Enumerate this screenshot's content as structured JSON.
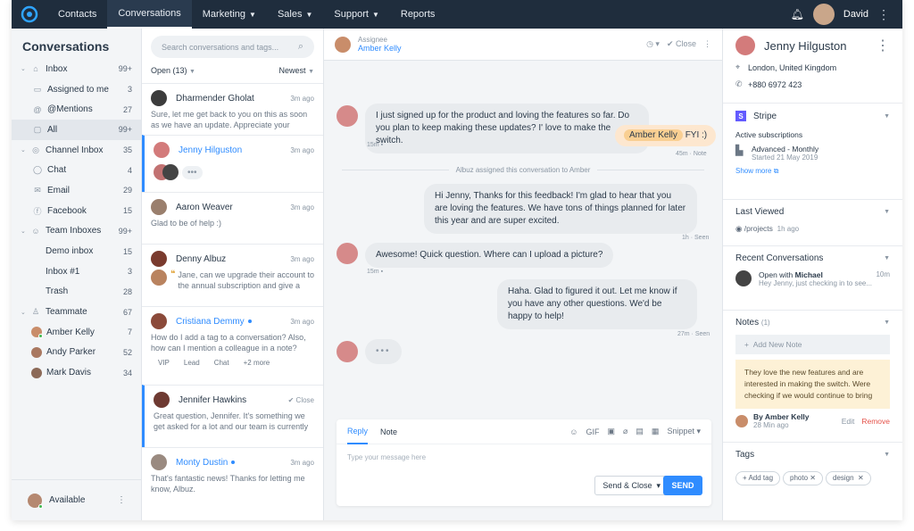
{
  "nav": {
    "items": [
      "Contacts",
      "Conversations",
      "Marketing",
      "Sales",
      "Support",
      "Reports"
    ],
    "user": "David"
  },
  "sidebar": {
    "title": "Conversations",
    "inbox": {
      "label": "Inbox",
      "count": "99+"
    },
    "assigned": {
      "label": "Assigned to me",
      "count": "3"
    },
    "mentions": {
      "label": "@Mentions",
      "count": "27"
    },
    "all": {
      "label": "All",
      "count": "99+"
    },
    "channel": {
      "label": "Channel Inbox",
      "count": "35"
    },
    "chat": {
      "label": "Chat",
      "count": "4"
    },
    "email": {
      "label": "Email",
      "count": "29"
    },
    "facebook": {
      "label": "Facebook",
      "count": "15"
    },
    "team": {
      "label": "Team Inboxes",
      "count": "99+"
    },
    "demo": {
      "label": "Demo inbox",
      "count": "15"
    },
    "inbox1": {
      "label": "Inbox #1",
      "count": "3"
    },
    "trash": {
      "label": "Trash",
      "count": "28"
    },
    "teammate": {
      "label": "Teammate",
      "count": "67"
    },
    "amber": {
      "label": "Amber Kelly",
      "count": "7"
    },
    "andy": {
      "label": "Andy Parker",
      "count": "52"
    },
    "mark": {
      "label": "Mark Davis",
      "count": "34"
    },
    "status": "Available"
  },
  "list": {
    "search_placeholder": "Search conversations and tags...",
    "filter_open": "Open (13)",
    "filter_sort": "Newest",
    "c1": {
      "name": "Dharmender Gholat",
      "time": "3m ago",
      "text": "Sure, let me get back to you on this as soon as we have an update. Appreciate your"
    },
    "c2": {
      "name": "Jenny Hilguston",
      "time": "3m ago"
    },
    "c3": {
      "name": "Aaron Weaver",
      "time": "3m ago",
      "text": "Glad to be of help :)"
    },
    "c4": {
      "name": "Denny Albuz",
      "time": "3m ago",
      "text": "Jane, can we upgrade their account to the annual subscription and give a"
    },
    "c5": {
      "name": "Cristiana Demmy",
      "time": "3m ago",
      "text": "How do I add a tag to a conversation? Also, how can I mention a colleague in a note?",
      "tags": [
        "VIP",
        "Lead",
        "Chat",
        "+2 more"
      ]
    },
    "c6": {
      "name": "Jennifer Hawkins",
      "time": "Close",
      "text": "Great question, Jennifer. It's something we get asked for a lot and our team is currently"
    },
    "c7": {
      "name": "Monty Dustin",
      "time": "3m ago",
      "text": "That's fantastic news! Thanks for letting me know, Albuz."
    }
  },
  "chat": {
    "assignee_label": "Assignee",
    "assignee": "Amber Kelly",
    "close": "Close",
    "m1": "I just signed up for the product and loving the features so far. Do you plan to keep making these updates? I' love to make the switch.",
    "m1_time": "15m",
    "m2_mention": "Amber Kelly",
    "m2": "FYI :)",
    "m2_meta": "45m · Note",
    "system": "Albuz assigned this conversation to Amber",
    "m3": "Hi Jenny, Thanks for this feedback! I'm glad to hear that you are loving the features. We have tons of things planned for later this year and are super excited.",
    "m3_meta": "1h · Seen",
    "m4": "Awesome! Quick question. Where can I upload a picture?",
    "m4_time": "15m",
    "m5": "Haha. Glad to figured it out. Let me know if you have any other questions. We'd be happy to help!",
    "m5_meta": "27m · Seen",
    "tab_reply": "Reply",
    "tab_note": "Note",
    "gif": "GIF",
    "snippet": "Snippet",
    "placeholder": "Type your message here",
    "send_close": "Send & Close",
    "send": "SEND"
  },
  "right": {
    "name": "Jenny Hilguston",
    "location": "London, United Kingdom",
    "phone": "+880 6972 423",
    "stripe": "Stripe",
    "active_subs": "Active subscriptions",
    "plan": "Advanced - Monthly",
    "plan_date": "Started 21 May 2019",
    "show_more": "Show more",
    "last_viewed": "Last Viewed",
    "lv_path": "/projects",
    "lv_time": "1h ago",
    "recent": "Recent Conversations",
    "rc_open": "Open with",
    "rc_who": "Michael",
    "rc_time": "10m",
    "rc_text": "Hey Jenny, just checking in to see...",
    "notes": "Notes",
    "notes_count": "(1)",
    "add_note": "Add New Note",
    "note_text": "They love the new features and are interested in making the switch. Were checking if we would continue to bring",
    "note_by": "By Amber Kelly",
    "note_time": "28 Min ago",
    "edit": "Edit",
    "remove": "Remove",
    "tags": "Tags",
    "add_tag": "+ Add tag",
    "tag1": "photo",
    "tag2": "design"
  }
}
